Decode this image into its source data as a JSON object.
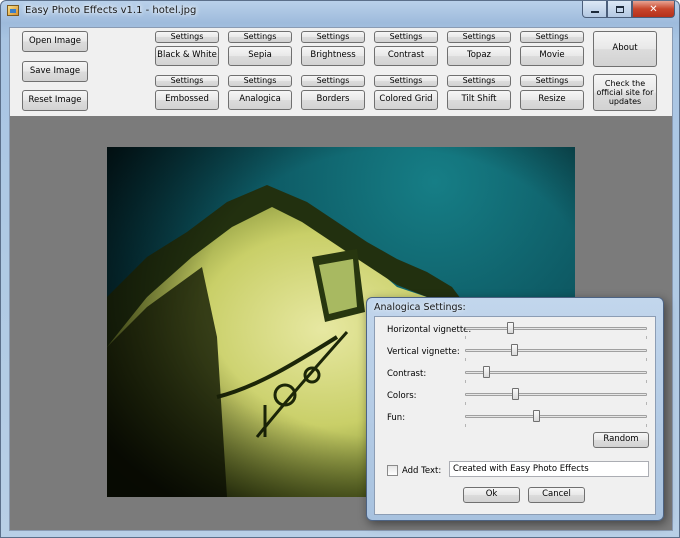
{
  "window": {
    "title": "Easy Photo Effects v1.1 - hotel.jpg",
    "icon": "photo-app-icon"
  },
  "left_buttons": [
    {
      "label": "Open Image"
    },
    {
      "label": "Save Image"
    },
    {
      "label": "Reset Image"
    }
  ],
  "effects_row1": [
    {
      "settings": "Settings",
      "label": "Black & White"
    },
    {
      "settings": "Settings",
      "label": "Sepia"
    },
    {
      "settings": "Settings",
      "label": "Brightness"
    },
    {
      "settings": "Settings",
      "label": "Contrast"
    },
    {
      "settings": "Settings",
      "label": "Topaz"
    },
    {
      "settings": "Settings",
      "label": "Movie"
    }
  ],
  "effects_row2": [
    {
      "settings": "Settings",
      "label": "Embossed"
    },
    {
      "settings": "Settings",
      "label": "Analogica"
    },
    {
      "settings": "Settings",
      "label": "Borders"
    },
    {
      "settings": "Settings",
      "label": "Colored Grid"
    },
    {
      "settings": "Settings",
      "label": "Tilt Shift"
    },
    {
      "settings": "Settings",
      "label": "Resize"
    }
  ],
  "right_buttons": {
    "about": "About",
    "updates": "Check the official site for updates"
  },
  "dialog": {
    "title": "Analogica Settings:",
    "sliders": [
      {
        "label": "Horizontal vignette:",
        "value": 0.24
      },
      {
        "label": "Vertical vignette:",
        "value": 0.26
      },
      {
        "label": "Contrast:",
        "value": 0.1
      },
      {
        "label": "Colors:",
        "value": 0.27
      },
      {
        "label": "Fun:",
        "value": 0.39
      }
    ],
    "random_label": "Random",
    "add_text_label": "Add Text:",
    "add_text_checked": false,
    "text_value": "Created with Easy Photo Effects",
    "ok_label": "Ok",
    "cancel_label": "Cancel"
  },
  "colors": {
    "canvas_bg": "#7b7b7b",
    "sky": "#0e5c66",
    "wall": "#d9dc86"
  }
}
